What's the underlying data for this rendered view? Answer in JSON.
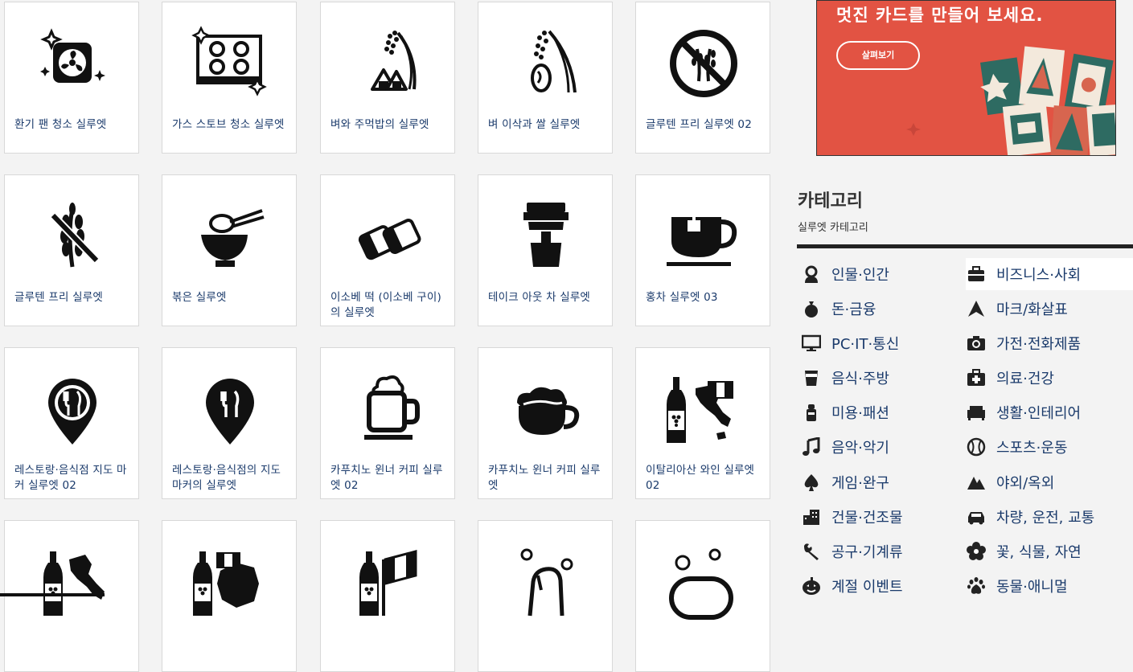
{
  "cards": [
    {
      "title": "환기 팬 청소 실루엣",
      "icon": "fan-cleaning-icon"
    },
    {
      "title": "가스 스토브 청소 실루엣",
      "icon": "gas-stove-icon"
    },
    {
      "title": "벼와 주먹밥의 실루엣",
      "icon": "rice-onigiri-icon"
    },
    {
      "title": "벼 이삭과 쌀 실루엣",
      "icon": "rice-ear-icon"
    },
    {
      "title": "글루텐 프리 실루엣 02",
      "icon": "gluten-free-circle-icon"
    },
    {
      "title": "글루텐 프리 실루엣",
      "icon": "gluten-free-icon"
    },
    {
      "title": "볶은 실루엣",
      "icon": "bowl-chopsticks-icon"
    },
    {
      "title": "이소베 떡 (이소베 구이)의 실루엣",
      "icon": "isobe-mochi-icon"
    },
    {
      "title": "테이크 아웃 차 실루엣",
      "icon": "takeout-cup-icon"
    },
    {
      "title": "홍차 실루엣 03",
      "icon": "tea-cup-icon"
    },
    {
      "title": "레스토랑·음식점 지도 마커 실루엣 02",
      "icon": "restaurant-marker-outline-icon"
    },
    {
      "title": "레스토랑·음식점의 지도 마커의 실루엣",
      "icon": "restaurant-marker-icon"
    },
    {
      "title": "카푸치노 윈너 커피 실루엣 02",
      "icon": "cappuccino-mug-icon"
    },
    {
      "title": "카푸치노 윈너 커피 실루엣",
      "icon": "cappuccino-cup-icon"
    },
    {
      "title": "이탈리아산 와인 실루엣 02",
      "icon": "italy-wine-icon"
    },
    {
      "title": "",
      "icon": "italy-wine-map-icon"
    },
    {
      "title": "",
      "icon": "france-wine-icon"
    },
    {
      "title": "",
      "icon": "italy-flag-wine-icon"
    },
    {
      "title": "",
      "icon": "bread-icon"
    },
    {
      "title": "",
      "icon": "soap-bubbles-icon"
    }
  ],
  "banner": {
    "headline": "멋진 카드를 만들어 보세요.",
    "button_label": "살펴보기",
    "bg_color": "#e25343"
  },
  "categories": {
    "heading": "카테고리",
    "subheading": "실루엣 카테고리",
    "items": [
      {
        "label": "인물·인간",
        "icon": "person-icon"
      },
      {
        "label": "비즈니스·사회",
        "icon": "briefcase-icon"
      },
      {
        "label": "돈·금융",
        "icon": "money-bag-icon"
      },
      {
        "label": "마크/화살표",
        "icon": "arrow-icon"
      },
      {
        "label": "PC·IT·통신",
        "icon": "monitor-icon"
      },
      {
        "label": "가전·전화제품",
        "icon": "camera-icon"
      },
      {
        "label": "음식·주방",
        "icon": "cup-icon"
      },
      {
        "label": "의료·건강",
        "icon": "medical-kit-icon"
      },
      {
        "label": "미용·패션",
        "icon": "lipstick-icon"
      },
      {
        "label": "생활·인테리어",
        "icon": "sofa-icon"
      },
      {
        "label": "음악·악기",
        "icon": "music-note-icon"
      },
      {
        "label": "스포츠·운동",
        "icon": "ball-icon"
      },
      {
        "label": "게임·완구",
        "icon": "spade-icon"
      },
      {
        "label": "야외/옥외",
        "icon": "mountain-icon"
      },
      {
        "label": "건물·건조물",
        "icon": "building-icon"
      },
      {
        "label": "차량, 운전, 교통",
        "icon": "car-icon"
      },
      {
        "label": "공구·기계류",
        "icon": "wrench-icon"
      },
      {
        "label": "꽃, 식물, 자연",
        "icon": "flower-icon"
      },
      {
        "label": "계절 이벤트",
        "icon": "pumpkin-icon"
      },
      {
        "label": "동물·애니멀",
        "icon": "paw-icon"
      }
    ]
  }
}
